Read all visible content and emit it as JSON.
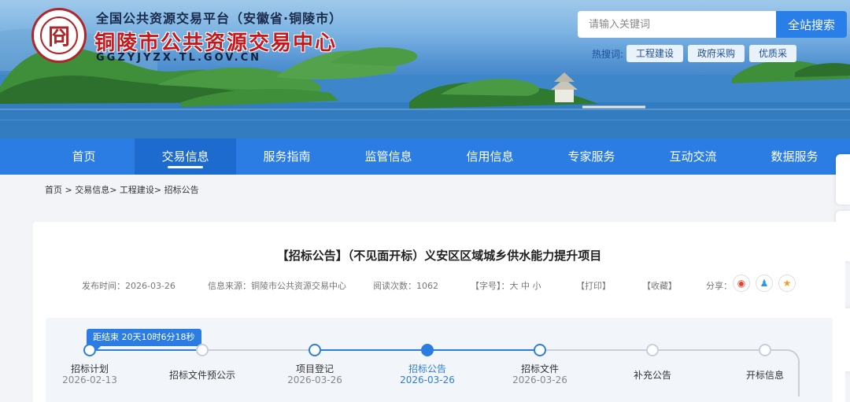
{
  "header": {
    "platform_subtitle": "全国公共资源交易平台（安徽省·铜陵市）",
    "site_name": "铜陵市公共资源交易中心",
    "domain": "GGZYJYZX.TL.GOV.CN",
    "logo_glyph": "冏"
  },
  "search": {
    "placeholder": "请输入关键词",
    "button_label": "全站搜索",
    "hot_label": "热搜词:",
    "hot_tags": [
      "工程建设",
      "政府采购",
      "优质采"
    ]
  },
  "nav": {
    "items": [
      "首页",
      "交易信息",
      "服务指南",
      "监管信息",
      "信用信息",
      "专家服务",
      "互动交流",
      "数据服务"
    ],
    "active": "交易信息"
  },
  "breadcrumb": "首页 > 交易信息> 工程建设> 招标公告",
  "article": {
    "title": "【招标公告】（不见面开标）义安区区域城乡供水能力提升项目",
    "publish_time": "发布时间：2026-03-26",
    "source": "信息来源：铜陵市公共资源交易中心",
    "read_count": "阅读次数：1062",
    "font_size": "【字号】：大 中 小",
    "print": "【打印】",
    "favorite": "【收藏】",
    "share_label": "分享："
  },
  "timeline": {
    "countdown": "距结束  20天10时6分18秒",
    "steps": [
      {
        "name": "招标计划",
        "date": "2026-02-13",
        "state": "done"
      },
      {
        "name": "招标文件预公示",
        "date": "",
        "state": "pending"
      },
      {
        "name": "项目登记",
        "date": "2026-03-26",
        "state": "done"
      },
      {
        "name": "招标公告",
        "date": "2026-03-26",
        "state": "current"
      },
      {
        "name": "招标文件",
        "date": "2026-03-26",
        "state": "done"
      },
      {
        "name": "补充公告",
        "date": "",
        "state": "pending"
      },
      {
        "name": "开标信息",
        "date": "",
        "state": "pending"
      }
    ]
  },
  "colors": {
    "primary": "#2b7de3",
    "site_name_red": "#c4181d"
  }
}
